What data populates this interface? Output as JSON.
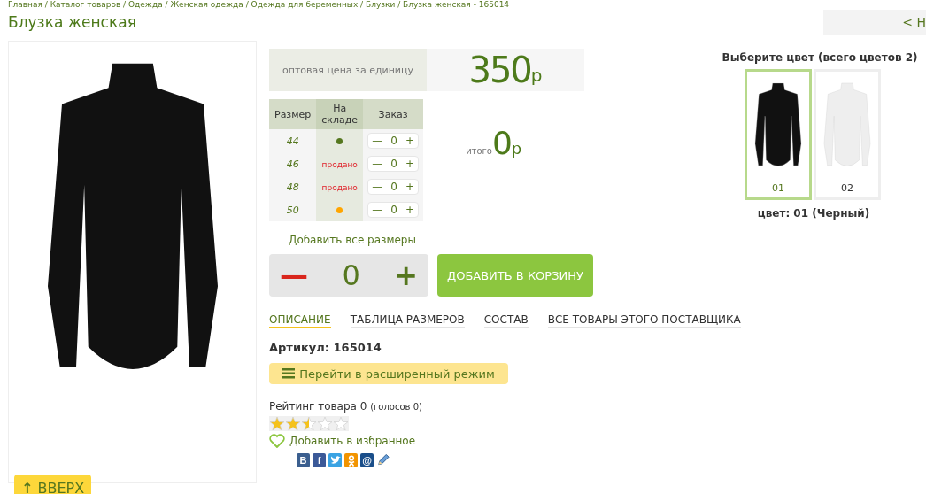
{
  "breadcrumb": "Главная / Каталог товаров / Одежда / Женская одежда / Одежда для беременных / Блузки / Блузка женская - 165014",
  "title": "Блузка женская",
  "back_button": "< Н",
  "scroll_top_button": {
    "arrow": "↑",
    "label": "ВВЕРХ"
  },
  "price": {
    "label": "оптовая цена за единицу",
    "value": "350",
    "currency": "р"
  },
  "sizes_table": {
    "columns": [
      "Размер",
      "На складе",
      "Заказ"
    ],
    "rows": [
      {
        "size": "44",
        "stock": {
          "kind": "dot",
          "color": "#55771f"
        },
        "minus": "—",
        "qty": "0",
        "plus": "+"
      },
      {
        "size": "46",
        "stock": {
          "kind": "text",
          "text": "продано"
        },
        "minus": "—",
        "qty": "0",
        "plus": "+"
      },
      {
        "size": "48",
        "stock": {
          "kind": "text",
          "text": "продано"
        },
        "minus": "—",
        "qty": "0",
        "plus": "+"
      },
      {
        "size": "50",
        "stock": {
          "kind": "dot",
          "color": "#ffa500"
        },
        "minus": "—",
        "qty": "0",
        "plus": "+"
      }
    ]
  },
  "total": {
    "label": "итого",
    "value": "0",
    "currency": "р"
  },
  "add_all_sizes": "Добавить все размеры",
  "quantity": {
    "minus": "—",
    "value": "0",
    "plus": "+"
  },
  "add_to_cart": "ДОБАВИТЬ В КОРЗИНУ",
  "tabs": [
    {
      "label": "ОПИСАНИЕ",
      "selected": true
    },
    {
      "label": "ТАБЛИЦА РАЗМЕРОВ",
      "selected": false
    },
    {
      "label": "СОСТАВ",
      "selected": false
    },
    {
      "label": "ВСЕ ТОВАРЫ ЭТОГО ПОСТАВЩИКА",
      "selected": false
    }
  ],
  "article": {
    "label": "Артикул:",
    "value": "165014"
  },
  "advanced_mode_button": "Перейти в расширенный режим",
  "rating": {
    "label": "Рейтинг товара 0",
    "votes": "(голосов 0)",
    "stars": 2.5
  },
  "favorite": "Добавить в избранное",
  "share": [
    {
      "kind": "vk",
      "glyph": "В"
    },
    {
      "kind": "facebook",
      "glyph": "f"
    },
    {
      "kind": "twitter"
    },
    {
      "kind": "odnoklassniki"
    },
    {
      "kind": "mail",
      "glyph": "@"
    },
    {
      "kind": "pencil"
    }
  ],
  "colors": {
    "title": "Выберите цвет (всего цветов 2)",
    "swatches": [
      {
        "code": "01",
        "color": "#111111",
        "selected": true
      },
      {
        "code": "02",
        "color": "#eeeeee",
        "selected": false
      }
    ],
    "current": "цвет: 01 (Черный)"
  }
}
